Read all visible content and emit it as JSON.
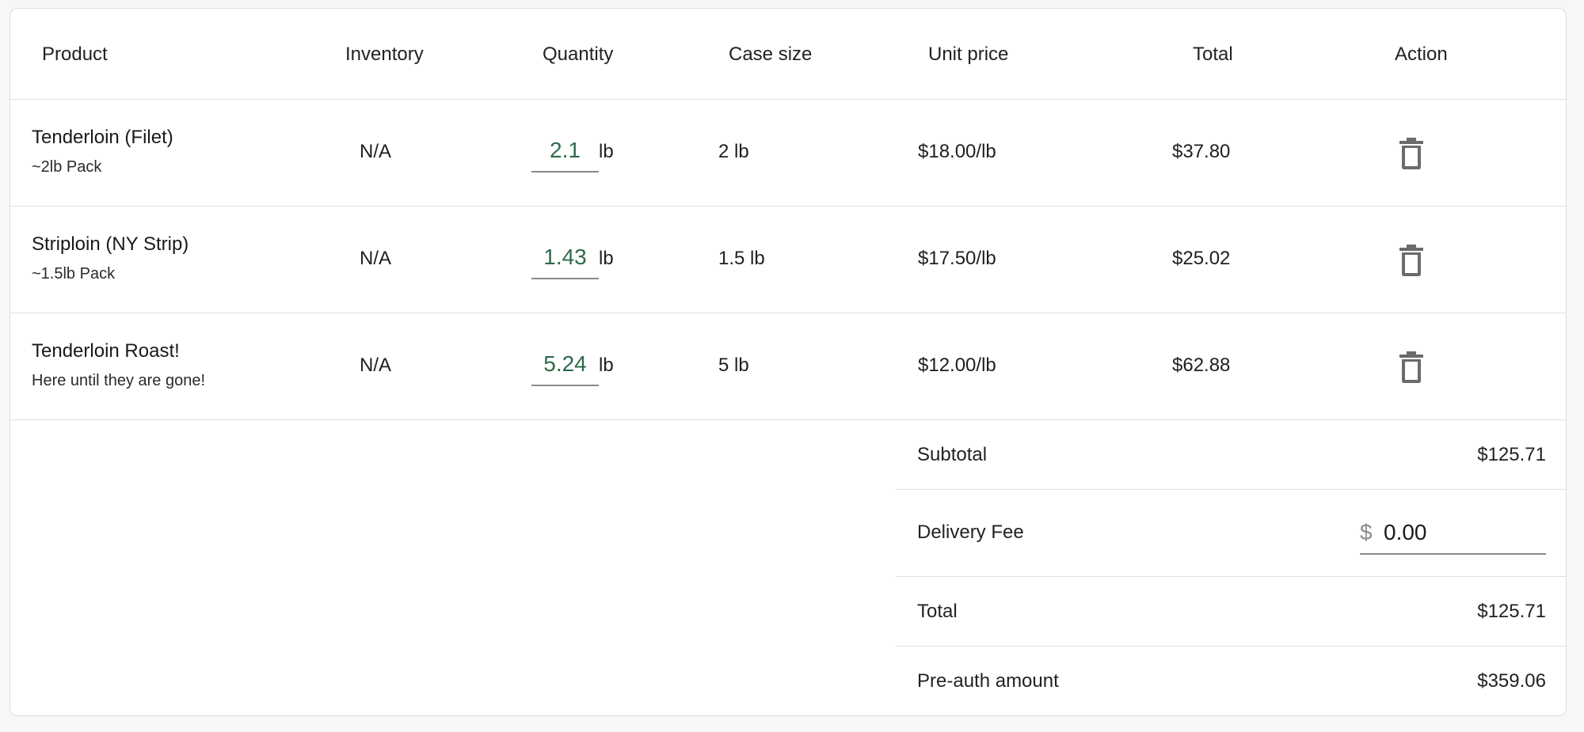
{
  "table": {
    "headers": {
      "product": "Product",
      "inventory": "Inventory",
      "quantity": "Quantity",
      "case_size": "Case size",
      "unit_price": "Unit price",
      "total": "Total",
      "action": "Action"
    },
    "rows": [
      {
        "name": "Tenderloin (Filet)",
        "subtitle": "~2lb Pack",
        "inventory": "N/A",
        "quantity": "2.1",
        "unit": "lb",
        "case_size": "2 lb",
        "unit_price": "$18.00/lb",
        "total": "$37.80",
        "action_icon": "trash-icon"
      },
      {
        "name": "Striploin (NY Strip)",
        "subtitle": "~1.5lb Pack",
        "inventory": "N/A",
        "quantity": "1.43",
        "unit": "lb",
        "case_size": "1.5 lb",
        "unit_price": "$17.50/lb",
        "total": "$25.02",
        "action_icon": "trash-icon"
      },
      {
        "name": "Tenderloin Roast!",
        "subtitle": "Here until they are gone!",
        "inventory": "N/A",
        "quantity": "5.24",
        "unit": "lb",
        "case_size": "5 lb",
        "unit_price": "$12.00/lb",
        "total": "$62.88",
        "action_icon": "trash-icon"
      }
    ]
  },
  "summary": {
    "subtotal_label": "Subtotal",
    "subtotal_value": "$125.71",
    "delivery_fee_label": "Delivery Fee",
    "delivery_fee_prefix": "$",
    "delivery_fee_value": "0.00",
    "total_label": "Total",
    "total_value": "$125.71",
    "preauth_label": "Pre-auth amount",
    "preauth_value": "$359.06"
  },
  "colors": {
    "quantity_text": "#2e6b4a",
    "border": "#e0e0e0",
    "icon": "#6b6b6b"
  }
}
